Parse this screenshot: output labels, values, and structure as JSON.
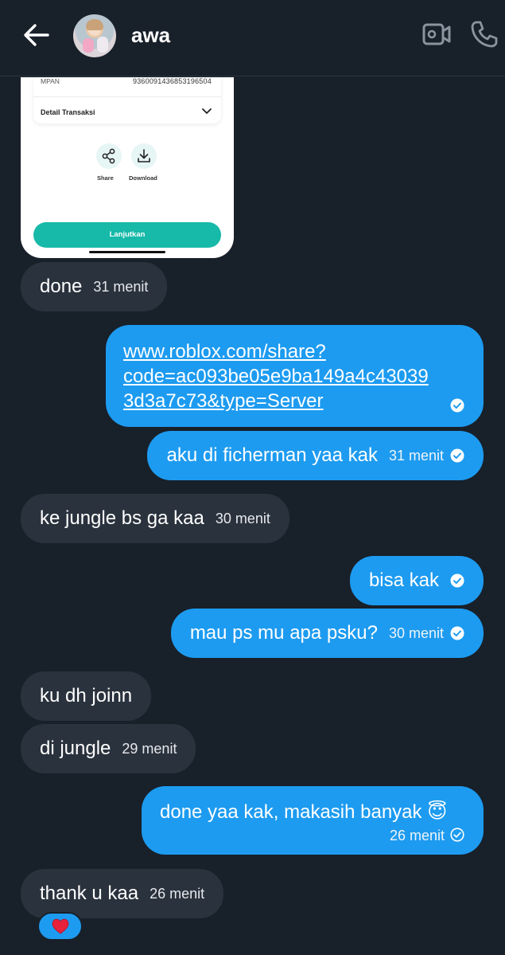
{
  "header": {
    "contact_name": "awa",
    "back_icon": "arrow-left-icon",
    "video_icon": "video-call-icon",
    "call_icon": "phone-icon"
  },
  "shared_image": {
    "mpan_label": "MPAN",
    "mpan_value": "9360091436853196504",
    "detail_label": "Detail Transaksi",
    "share_label": "Share",
    "download_label": "Download",
    "continue_label": "Lanjutkan",
    "accent_color": "#17b9a8"
  },
  "messages": [
    {
      "side": "in",
      "text": "done",
      "time": "31 menit"
    },
    {
      "side": "out",
      "text": "www.roblox.com/share?code=ac093be05e9ba149a4c430393d3a7c73&type=Server",
      "link_line1": "www.roblox.com/share?",
      "link_line2": "code=ac093be05e9ba149a4c43039",
      "link_line3": "3d3a7c73&type=Server",
      "time": ""
    },
    {
      "side": "out",
      "text": "aku di ficherman yaa kak",
      "time": "31 menit"
    },
    {
      "side": "in",
      "text": "ke jungle bs ga kaa",
      "time": "30 menit"
    },
    {
      "side": "out",
      "text": "bisa kak",
      "time": ""
    },
    {
      "side": "out",
      "text": "mau ps mu apa psku?",
      "time": "30 menit"
    },
    {
      "side": "in",
      "text": "ku dh joinn",
      "time": ""
    },
    {
      "side": "in",
      "text": "di jungle",
      "time": "29 menit"
    },
    {
      "side": "out",
      "text": "done yaa kak, makasih banyak 😇",
      "time": "26 menit"
    },
    {
      "side": "in",
      "text": "thank u kaa",
      "time": "26 menit"
    }
  ],
  "reaction": {
    "emoji": "❤️"
  },
  "colors": {
    "background": "#18202a",
    "incoming_bubble": "#2a323d",
    "outgoing_bubble": "#1d9bf0"
  }
}
